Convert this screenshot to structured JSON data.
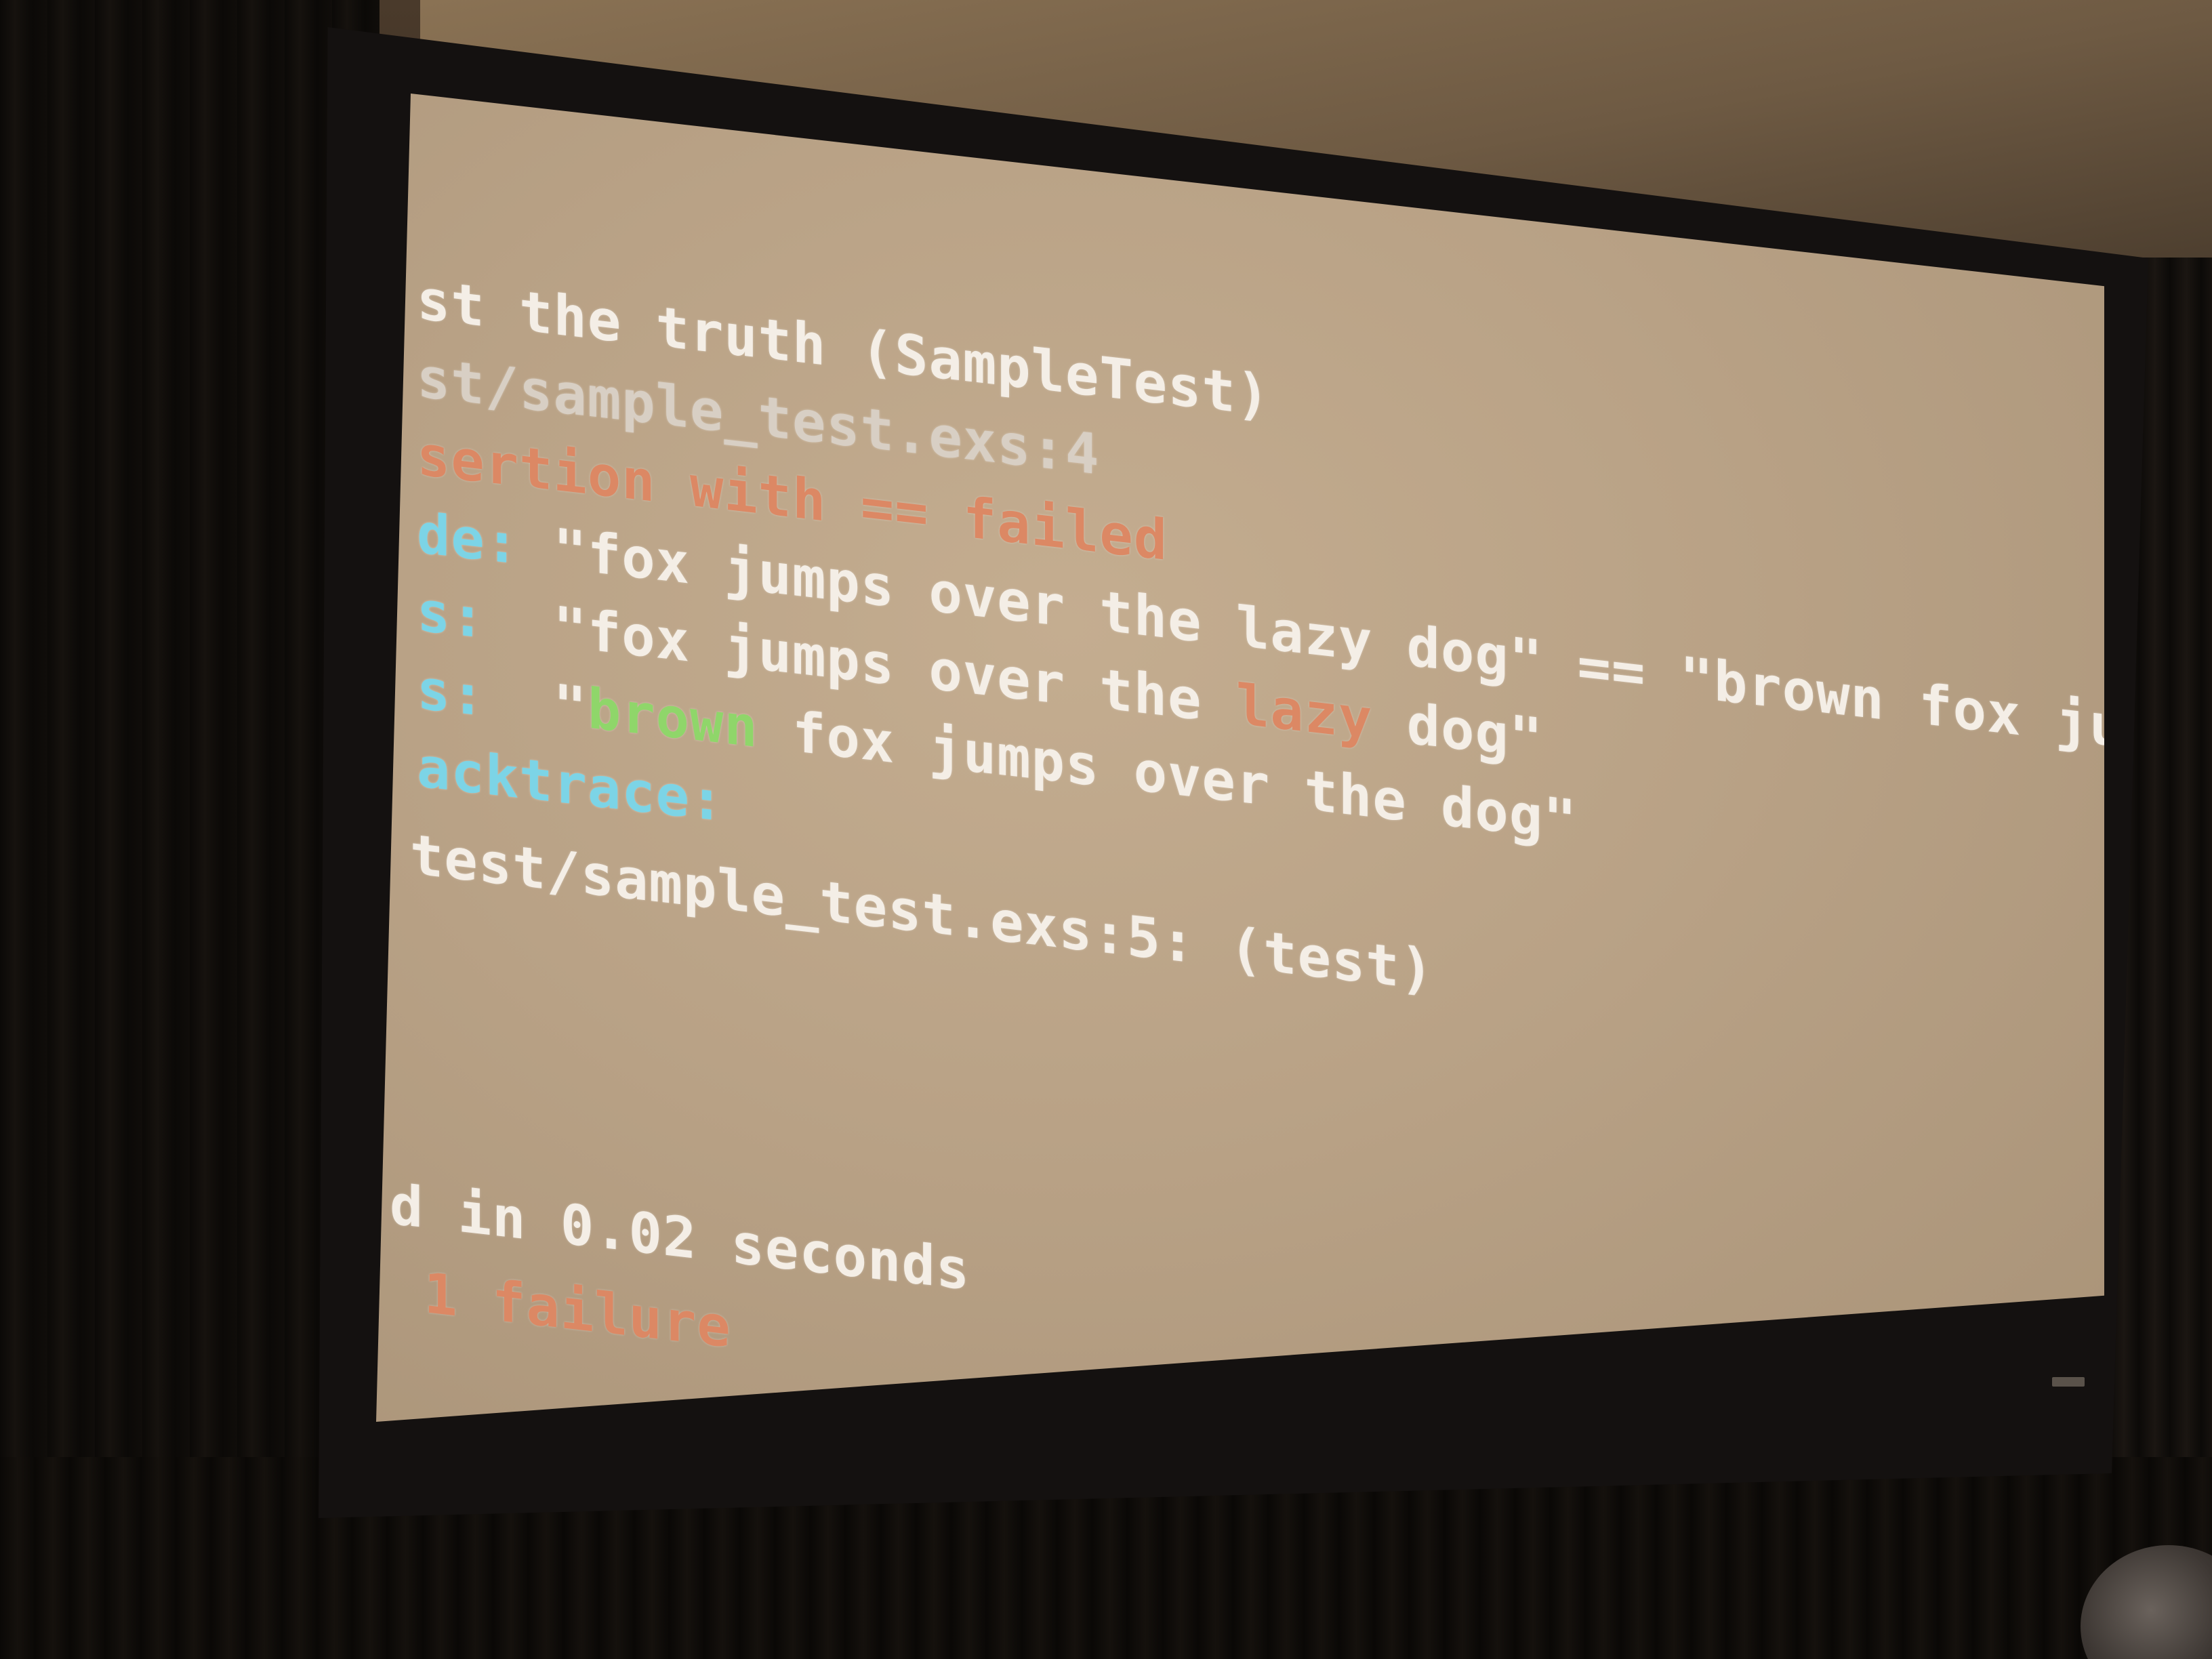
{
  "terminal": {
    "line1": "st the truth (SampleTest)",
    "line2": "st/sample_test.exs:4",
    "line3": "sertion with == failed",
    "line4_label": "de:",
    "line4_text": " \"fox jumps over the lazy dog\" == \"brown fox jumps over the dog",
    "line5_label": "s:",
    "line5_pre": "  \"fox jumps over the ",
    "line5_highlight": "lazy",
    "line5_post": " dog\"",
    "line6_label": "s:",
    "line6_pre": "  \"",
    "line6_highlight": "brown",
    "line6_post": " fox jumps over the dog\"",
    "line7": "acktrace:",
    "line8": "test/sample_test.exs:5: (test)",
    "line9": "d in 0.02 seconds",
    "line10": " 1 failure"
  },
  "colors": {
    "screen": "#bfa98c",
    "text_white": "#f4eee6",
    "text_red": "#dc8864",
    "text_cyan": "#7cd4e6",
    "text_green": "#8fd66a"
  }
}
